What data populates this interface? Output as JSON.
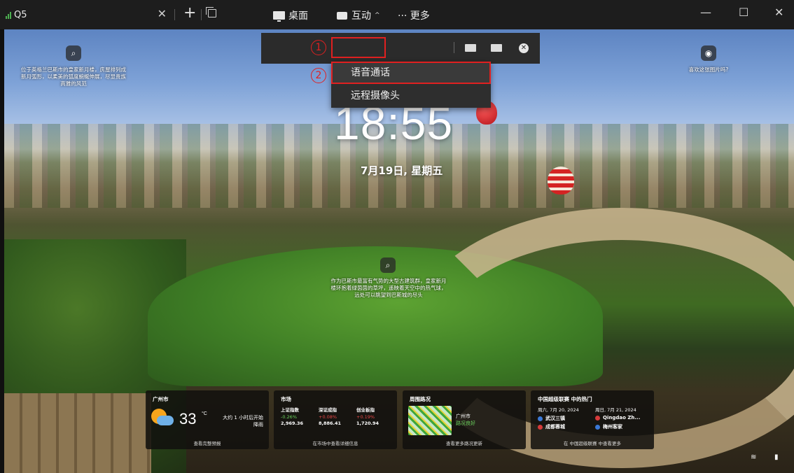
{
  "window": {
    "tab_title": "Q5",
    "tab_close": "✕",
    "new_tab": "+",
    "minimize": "—",
    "maximize": "☐",
    "close": "✕"
  },
  "toolbar": {
    "desktop_label": "桌面",
    "interact_label": "互动",
    "interact_chevron": "^",
    "more_label": "··· 更多"
  },
  "annotations": {
    "step1": "1",
    "step2": "2",
    "highlight_color": "#e02020"
  },
  "dropdown": {
    "items": [
      {
        "label": "语音通话"
      },
      {
        "label": "远程摄像头"
      }
    ]
  },
  "lockscreen": {
    "time": "18:55",
    "date": "7月19日, 星期五",
    "spot_left_text": "位于英格兰巴斯市的皇家新月楼，房屋排列成新月弧形，以柔美的弧度蜿蜒伸展，尽显贵族高雅的风范",
    "spot_right_text": "喜欢这张图片吗?",
    "spot_center_text": "作为巴斯市最富有气势的大型古建筑群，皇家新月楼环抱着绿茵茵的草坪，遥映着天空中的热气球，远处可以眺望到巴斯城的尽头"
  },
  "cards": {
    "weather": {
      "city": "广州市",
      "temp": "33",
      "unit": "°C",
      "desc_line1": "大约 1 小时后开始",
      "desc_line2": "降雨",
      "footer": "查看完整预报"
    },
    "market": {
      "title": "市场",
      "indices": [
        {
          "name": "上证指数",
          "change": "-0.26%",
          "value": "2,969.36"
        },
        {
          "name": "深证成指",
          "change": "+0.08%",
          "value": "8,886.41"
        },
        {
          "name": "创业板指",
          "change": "+0.19%",
          "value": "1,720.94"
        }
      ],
      "footer": "在市场中查看详细信息"
    },
    "traffic": {
      "title": "周围路况",
      "city": "广州市",
      "status": "路况良好",
      "footer": "查看更多路况更新"
    },
    "sports": {
      "title": "中国超级联赛 中的热门",
      "date1": "周六, 7月 20, 2024",
      "date2": "周日, 7月 21, 2024",
      "team1": "武汉三镇",
      "team2": "成都蓉城",
      "team3": "Qingdao Zh...",
      "team4": "梅州客家",
      "footer": "在 中国超级联赛 中查看更多"
    }
  },
  "colors": {
    "toolbar_bg": "#2b2b2b",
    "titlebar_bg": "#1d1d1d",
    "card_bg": "#12100e",
    "positive": "#e84848",
    "traffic_good": "#6cd45e"
  }
}
